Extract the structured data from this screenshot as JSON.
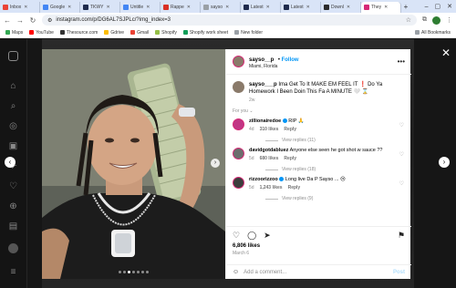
{
  "browser": {
    "tabs": [
      {
        "label": "Inbox",
        "color": "#ea4335"
      },
      {
        "label": "Google",
        "color": "#4285f4"
      },
      {
        "label": "TKWY",
        "color": "#1f2b4d"
      },
      {
        "label": "Untitle",
        "color": "#4285f4"
      },
      {
        "label": "Rappe",
        "color": "#d93025"
      },
      {
        "label": "sayso",
        "color": "#9aa0a6"
      },
      {
        "label": "Latest",
        "color": "#1f2b4d"
      },
      {
        "label": "Latest",
        "color": "#1f2b4d"
      },
      {
        "label": "Downl",
        "color": "#2b2b2b"
      },
      {
        "label": "They",
        "color": "#d62976",
        "active": true
      }
    ],
    "url": "instagram.com/p/DG6AL7SJPLc/?img_index=3",
    "bookmarks": [
      {
        "label": "Maps",
        "color": "#34a853"
      },
      {
        "label": "YouTube",
        "color": "#ff0000"
      },
      {
        "label": "Thesource.com",
        "color": "#333333"
      },
      {
        "label": "Gdrive",
        "color": "#fbbc04"
      },
      {
        "label": "Gmail",
        "color": "#ea4335"
      },
      {
        "label": "Shopify",
        "color": "#95bf47"
      },
      {
        "label": "Shopify work sheet",
        "color": "#0f9d58"
      },
      {
        "label": "New folder",
        "color": "#9aa0a6"
      }
    ],
    "all_bookmarks": "All Bookmarks"
  },
  "post": {
    "username": "sayso__p",
    "follow": "Follow",
    "location": "Miami, Florida",
    "caption_user": "sayso___p",
    "caption_text": "Ima Get To It MAKE EM FEEL IT ❗ Do Ya Homework I Been Doin This Fa A MINUTE 🤍 ⌛",
    "caption_time": "2w",
    "for_you": "For you",
    "comments": [
      {
        "user": "zillionairedoe",
        "verified": true,
        "text": "RIP 🙏",
        "time": "4d",
        "likes": "310 likes",
        "reply": "Reply",
        "view_replies": "View replies (11)",
        "avatar": "#c13584"
      },
      {
        "user": "davidgotdabluez",
        "verified": false,
        "text": "Anyone else seen he got shot w sauce ??",
        "time": "5d",
        "likes": "680 likes",
        "reply": "Reply",
        "view_replies": "View replies (18)",
        "avatar": "#6d6d6d"
      },
      {
        "user": "rizzoorizzoo",
        "verified": true,
        "text": "Long live Da P Sayso ... 😢",
        "time": "5d",
        "likes": "1,243 likes",
        "reply": "Reply",
        "view_replies": "View replies (9)",
        "avatar": "#3d3d3d"
      }
    ],
    "likes": "6,806 likes",
    "date": "March 6",
    "add_comment_placeholder": "Add a comment...",
    "post_label": "Post"
  }
}
